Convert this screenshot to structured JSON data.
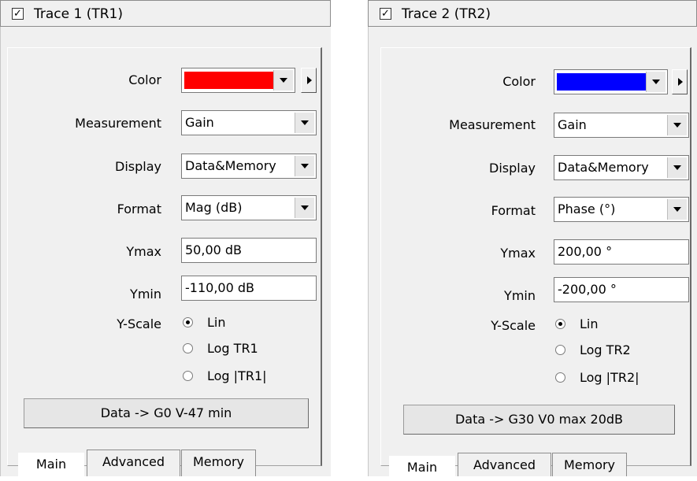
{
  "panels": [
    {
      "title": "Trace 1 (TR1)",
      "checked": true,
      "color_label": "Color",
      "color_value": "#ff0000",
      "measurement_label": "Measurement",
      "measurement_value": "Gain",
      "display_label": "Display",
      "display_value": "Data&Memory",
      "format_label": "Format",
      "format_value": "Mag (dB)",
      "ymax_label": "Ymax",
      "ymax_value": "50,00 dB",
      "ymin_label": "Ymin",
      "ymin_value": "-110,00 dB",
      "yscale_label": "Y-Scale",
      "yscale_options": [
        "Lin",
        "Log TR1",
        "Log |TR1|"
      ],
      "yscale_selected": "Lin",
      "action_button": "Data -> G0 V-47 min",
      "tabs": [
        "Main",
        "Advanced",
        "Memory"
      ],
      "active_tab": "Main"
    },
    {
      "title": "Trace 2 (TR2)",
      "checked": true,
      "color_label": "Color",
      "color_value": "#0000ff",
      "measurement_label": "Measurement",
      "measurement_value": "Gain",
      "display_label": "Display",
      "display_value": "Data&Memory",
      "format_label": "Format",
      "format_value": "Phase (°)",
      "ymax_label": "Ymax",
      "ymax_value": "200,00 °",
      "ymin_label": "Ymin",
      "ymin_value": "-200,00 °",
      "yscale_label": "Y-Scale",
      "yscale_options": [
        "Lin",
        "Log TR2",
        "Log |TR2|"
      ],
      "yscale_selected": "Lin",
      "action_button": "Data -> G30 V0 max 20dB",
      "tabs": [
        "Main",
        "Advanced",
        "Memory"
      ],
      "active_tab": "Main"
    }
  ],
  "icons": {
    "checkbox": "checkmark-icon",
    "dropdown": "chevron-down-icon",
    "expand": "triangle-right-icon"
  }
}
